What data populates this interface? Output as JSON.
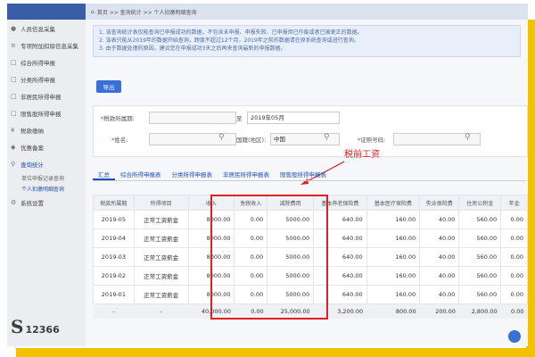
{
  "sidebar": {
    "items": [
      {
        "label": "人员信息采集",
        "icon": "user-icon"
      },
      {
        "label": "专项附加扣除信息采集",
        "icon": "list-icon"
      },
      {
        "label": "综合所得申报",
        "icon": "doc-icon"
      },
      {
        "label": "分类所得申报",
        "icon": "doc-icon"
      },
      {
        "label": "非居民所得申报",
        "icon": "doc-icon"
      },
      {
        "label": "限售股所得申报",
        "icon": "doc-icon"
      },
      {
        "label": "税款缴纳",
        "icon": "coin-icon"
      },
      {
        "label": "优惠备案",
        "icon": "stamp-icon"
      },
      {
        "label": "查询统计",
        "icon": "search-icon"
      }
    ],
    "sub_items": [
      "单位申报记录查询",
      "个人扣缴明细查询"
    ],
    "settings_label": "系统设置",
    "logo_text": "12366"
  },
  "breadcrumb": "首页 >> 查询统计 >> 个人扣缴明细查询",
  "active_tab": "个人扣缴明细查询",
  "notices": [
    "1. 该查询统计表仅能查询已申报成功的数据，不包含未申报、申报失败、已申报但已作废或者已被更正的数据。",
    "2. 该表只能从2019年的数据开始查询，跨度不超过12个月，2019年之前的数据请在原系统查询或进行查询。",
    "3. 由于数据处理的原因，建议您在申报成功3天之后再来查询最新的申报数据。"
  ],
  "export_label": "导出",
  "filters": {
    "period_label": "税款所属期:",
    "period_to_label": "至",
    "period_end": "2019年05月",
    "name_label": "姓名:",
    "nationality_label": "国籍(地区):",
    "nationality_value": "中国",
    "id_label": "证照号码:"
  },
  "annotation": "税前工资",
  "tabs": [
    "汇总",
    "综合所得申报表",
    "分类所得申报表",
    "非居民所得申报表",
    "限售股所得申报表"
  ],
  "table": {
    "headers": [
      "税款所属期",
      "所得项目",
      "收入",
      "免税收入",
      "减除费用",
      "基本养老保险费",
      "基本医疗保险费",
      "失业保险费",
      "住房公积金",
      "年金"
    ],
    "rows": [
      [
        "2019-05",
        "正常工资薪金",
        "8000.00",
        "0.00",
        "5000.00",
        "640.00",
        "160.00",
        "40.00",
        "560.00",
        "0.00"
      ],
      [
        "2019-04",
        "正常工资薪金",
        "8000.00",
        "0.00",
        "5000.00",
        "640.00",
        "160.00",
        "40.00",
        "560.00",
        "0.00"
      ],
      [
        "2019-03",
        "正常工资薪金",
        "8000.00",
        "0.00",
        "5000.00",
        "640.00",
        "160.00",
        "40.00",
        "560.00",
        "0.00"
      ],
      [
        "2019-02",
        "正常工资薪金",
        "8000.00",
        "0.00",
        "5000.00",
        "640.00",
        "160.00",
        "40.00",
        "560.00",
        "0.00"
      ],
      [
        "2019-01",
        "正常工资薪金",
        "8000.00",
        "0.00",
        "5000.00",
        "640.00",
        "160.00",
        "40.00",
        "560.00",
        "0.00"
      ]
    ],
    "totals": [
      "-",
      "-",
      "40,000.00",
      "0.00",
      "25,000.00",
      "3,200.00",
      "800.00",
      "200.00",
      "2,800.00",
      "0.00"
    ]
  },
  "colors": {
    "accent": "#3a6fd8",
    "annotation": "#e02020",
    "frame": "#f2c200"
  }
}
